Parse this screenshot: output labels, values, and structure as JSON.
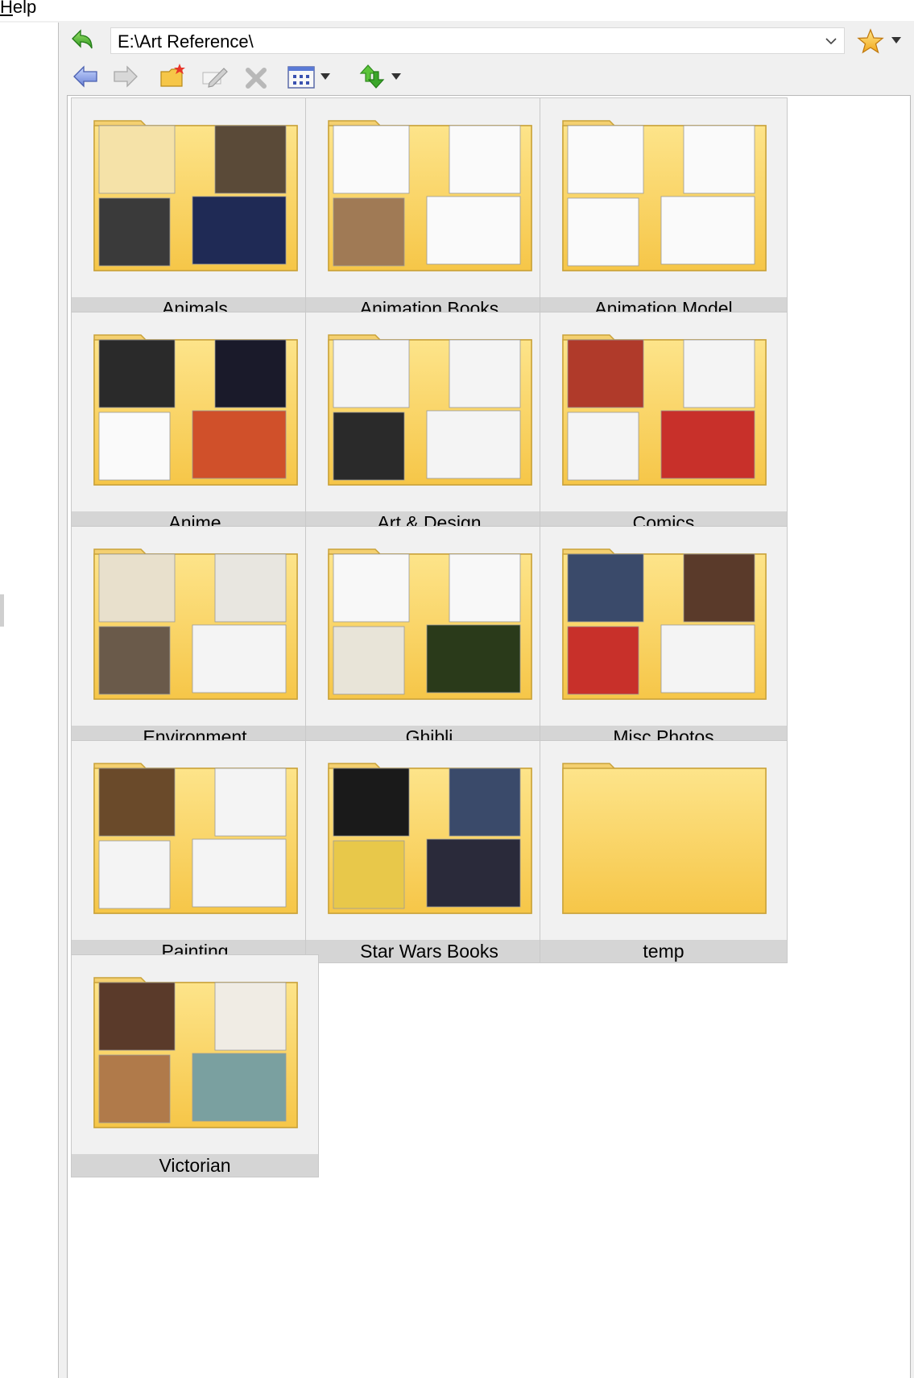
{
  "menu": {
    "help_rest": "elp",
    "help_ul": "H"
  },
  "address": {
    "value": "E:\\Art Reference\\"
  },
  "colors": {
    "folder_body": "#fde48a",
    "folder_body_dark": "#f6c648",
    "tile_bg": "#f1f1f1",
    "label_bg": "#d5d5d5"
  },
  "folders": [
    {
      "name": "Animals",
      "thumbs": [
        "#f5e2a8",
        "#5a4a38",
        "#3a3a3a",
        "#1f2a55"
      ]
    },
    {
      "name": "Animation Books",
      "thumbs": [
        "#fafafa",
        "#fafafa",
        "#a07a55",
        "#fafafa"
      ]
    },
    {
      "name": "Animation Model",
      "thumbs": [
        "#fafafa",
        "#fafafa",
        "#fafafa",
        "#fafafa"
      ]
    },
    {
      "name": "Anime",
      "thumbs": [
        "#2a2a2a",
        "#1a1a2a",
        "#fafafa",
        "#d0502a"
      ]
    },
    {
      "name": "Art & Design",
      "thumbs": [
        "#f4f4f4",
        "#f4f4f4",
        "#2a2a2a",
        "#f4f4f4"
      ]
    },
    {
      "name": "Comics",
      "thumbs": [
        "#b03a2a",
        "#f4f4f4",
        "#f4f4f4",
        "#c8302a"
      ]
    },
    {
      "name": "Environment",
      "thumbs": [
        "#e8e0cc",
        "#e8e6e0",
        "#6a5a4a",
        "#f4f4f4"
      ]
    },
    {
      "name": "Ghibli",
      "thumbs": [
        "#f8f8f8",
        "#f8f8f8",
        "#e8e4d8",
        "#2a3a1a"
      ]
    },
    {
      "name": "Misc Photos",
      "thumbs": [
        "#3a4a6a",
        "#5a3a2a",
        "#c8302a",
        "#f4f4f4"
      ]
    },
    {
      "name": "Painting",
      "thumbs": [
        "#6a4a2a",
        "#f4f4f4",
        "#f4f4f4",
        "#f4f4f4"
      ]
    },
    {
      "name": "Star Wars Books",
      "thumbs": [
        "#1a1a1a",
        "#3a4a6a",
        "#e8c84a",
        "#2a2a3a"
      ]
    },
    {
      "name": "temp",
      "thumbs": []
    },
    {
      "name": "Victorian",
      "thumbs": [
        "#5a3a2a",
        "#f0ece4",
        "#b07a4a",
        "#7aa0a0"
      ]
    }
  ]
}
